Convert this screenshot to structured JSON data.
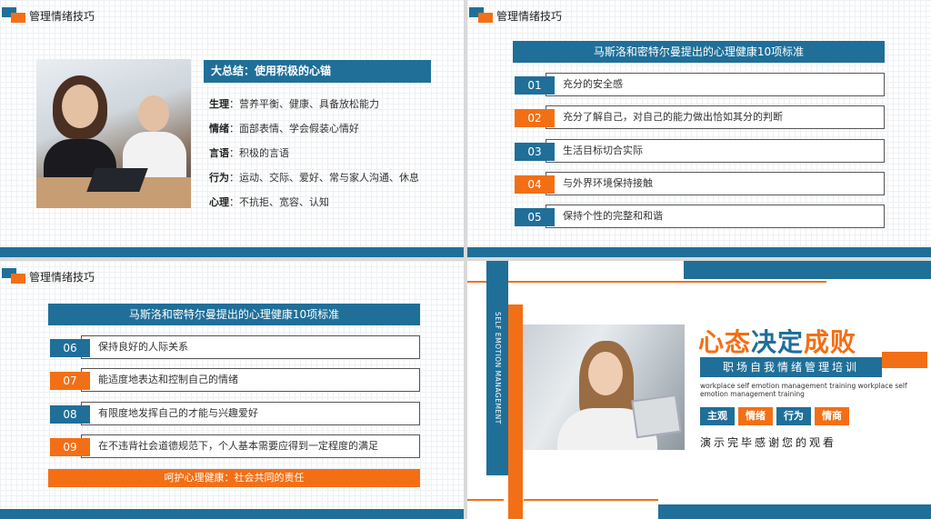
{
  "header_title": "管理情绪技巧",
  "slide1": {
    "title": "大总结：使用积极的心锚",
    "rows": [
      {
        "label": "生理",
        "text": "：营养平衡、健康、具备放松能力"
      },
      {
        "label": "情绪",
        "text": "：面部表情、学会假装心情好"
      },
      {
        "label": "言语",
        "text": "：积极的言语"
      },
      {
        "label": "行为",
        "text": "：运动、交际、爱好、常与家人沟通、休息"
      },
      {
        "label": "心理",
        "text": "：不抗拒、宽容、认知"
      }
    ]
  },
  "slide2": {
    "title": "马斯洛和密特尔曼提出的心理健康10项标准",
    "items": [
      {
        "num": "01",
        "text": "充分的安全感"
      },
      {
        "num": "02",
        "text": "充分了解自己，对自己的能力做出恰如其分的判断"
      },
      {
        "num": "03",
        "text": "生活目标切合实际"
      },
      {
        "num": "04",
        "text": "与外界环境保持接触"
      },
      {
        "num": "05",
        "text": "保持个性的完整和和谐"
      }
    ]
  },
  "slide3": {
    "title": "马斯洛和密特尔曼提出的心理健康10项标准",
    "items": [
      {
        "num": "06",
        "text": "保持良好的人际关系"
      },
      {
        "num": "07",
        "text": "能适度地表达和控制自己的情绪"
      },
      {
        "num": "08",
        "text": "有限度地发挥自己的才能与兴趣爱好"
      },
      {
        "num": "09",
        "text": "在不违背社会道德规范下，个人基本需要应得到一定程度的满足"
      }
    ],
    "footer": "呵护心理健康：社会共同的责任"
  },
  "slide4": {
    "vertical_text": "SELF EMOTION MANAGEMENT",
    "title_parts": [
      "心态",
      "决定",
      "成败"
    ],
    "subtitle": "职场自我情绪管理培训",
    "english": "workplace self emotion management training workplace self emotion management training",
    "tags": [
      "主观",
      "情绪",
      "行为",
      "情商"
    ],
    "thanks": "演示完毕感谢您的观看"
  },
  "colors": {
    "blue": "#1f6f99",
    "orange": "#f36f16"
  }
}
